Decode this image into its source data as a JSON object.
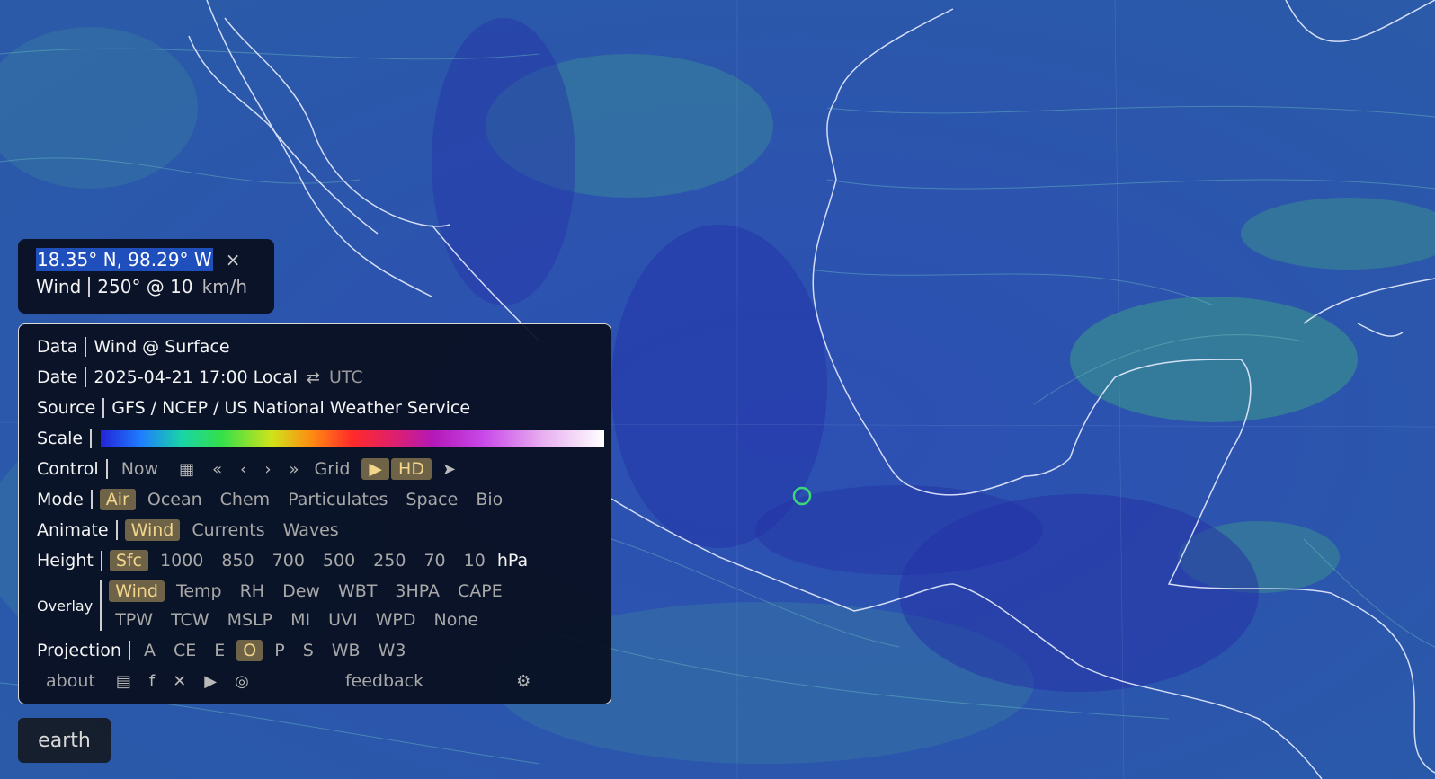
{
  "location": {
    "coords": "18.35° N, 98.29° W",
    "close_icon": "×",
    "var_label": "Wind",
    "value": "250° @ 10",
    "unit": "km/h"
  },
  "menu": {
    "data": {
      "label": "Data",
      "value": "Wind @ Surface"
    },
    "date": {
      "label": "Date",
      "value": "2025-04-21 17:00 Local",
      "swap_icon": "⇄",
      "alt": "UTC"
    },
    "source": {
      "label": "Source",
      "value": "GFS / NCEP / US National Weather Service"
    },
    "scale": {
      "label": "Scale"
    },
    "control": {
      "label": "Control",
      "now": "Now",
      "calendar_icon": "▦",
      "back_day": "«",
      "back": "‹",
      "forward": "›",
      "forward_day": "»",
      "grid": "Grid",
      "play": "▶",
      "hd": "HD",
      "locate_icon": "➤"
    },
    "mode": {
      "label": "Mode",
      "options": [
        "Air",
        "Ocean",
        "Chem",
        "Particulates",
        "Space",
        "Bio"
      ],
      "selected": "Air"
    },
    "animate": {
      "label": "Animate",
      "options": [
        "Wind",
        "Currents",
        "Waves"
      ],
      "selected": "Wind"
    },
    "height": {
      "label": "Height",
      "options": [
        "Sfc",
        "1000",
        "850",
        "700",
        "500",
        "250",
        "70",
        "10"
      ],
      "unit": "hPa",
      "selected": "Sfc"
    },
    "overlay": {
      "label": "Overlay",
      "row1": [
        "Wind",
        "Temp",
        "RH",
        "Dew",
        "WBT",
        "3HPA",
        "CAPE"
      ],
      "row2": [
        "TPW",
        "TCW",
        "MSLP",
        "MI",
        "UVI",
        "WPD",
        "None"
      ],
      "selected": "Wind"
    },
    "projection": {
      "label": "Projection",
      "options": [
        "A",
        "CE",
        "E",
        "O",
        "P",
        "S",
        "WB",
        "W3"
      ],
      "selected": "O"
    },
    "footer": {
      "about": "about",
      "news_icon": "▤",
      "facebook_icon": "f",
      "bluesky_icon": "✕",
      "youtube_icon": "▶",
      "instagram_icon": "◎",
      "feedback": "feedback",
      "settings_icon": "⚙"
    }
  },
  "earth_button": "earth",
  "colors": {
    "ocean": "#2a4aa8",
    "highlight": "#f3d58c",
    "selected_bg": "#6e6346",
    "marker": "#39d977"
  }
}
